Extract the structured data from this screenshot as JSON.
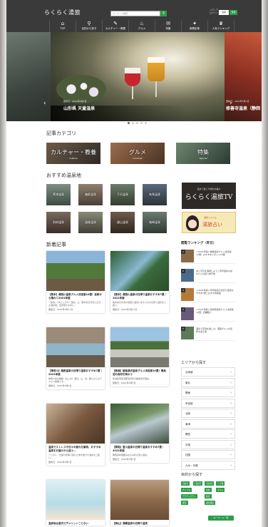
{
  "header": {
    "logo": "らくらく湯旅",
    "search_placeholder": "キーワード検索",
    "search_icon": "search-icon",
    "small_text_1": "メディア",
    "small_text_2": "ログイン",
    "button_1": "会員",
    "button_2": "登録"
  },
  "nav": [
    {
      "label": "TOP",
      "icon": "home-icon",
      "glyph": "⌂"
    },
    {
      "label": "目的から探す",
      "icon": "search-icon",
      "glyph": "⚲"
    },
    {
      "label": "カルチャー・教養",
      "icon": "book-icon",
      "glyph": "✎"
    },
    {
      "label": "グルメ",
      "icon": "food-icon",
      "glyph": "♨"
    },
    {
      "label": "特集",
      "icon": "mail-icon",
      "glyph": "✉"
    },
    {
      "label": "新着記事",
      "icon": "bell-icon",
      "glyph": "✦"
    },
    {
      "label": "人気ランキング",
      "icon": "crown-icon",
      "glyph": "♛"
    }
  ],
  "hero": {
    "date": "更新日：2021年5月8日",
    "title": "山形県 天童温泉",
    "date_right": "更新日：2021年3月2日",
    "title_right": "修善寺温泉（静岡",
    "arrow_left": "‹",
    "arrow_right": "›"
  },
  "sections": {
    "categories": "記事カテゴリ",
    "recommended": "おすすめ温泉地",
    "new_articles": "新着記事",
    "ranking": "閲覧ランキング（昨日）",
    "area": "エリアから探す",
    "purpose": "目的から探す"
  },
  "categories": [
    {
      "title": "カルチャー・教養",
      "sub": "Culture"
    },
    {
      "title": "グルメ",
      "sub": "Gourmet"
    },
    {
      "title": "特集",
      "sub": "Special"
    }
  ],
  "onsen": [
    "草津温泉",
    "箱根温泉",
    "下呂温泉",
    "有馬温泉",
    "別府温泉",
    "道後温泉",
    "銀山温泉",
    "城崎温泉"
  ],
  "banners": {
    "tv_sub": "温泉で過ごす旅をお届け",
    "tv_title": "らくらく湯旅TV",
    "uranai_sub": "温泉ソムリエ",
    "uranai_title": "湯旅占い"
  },
  "articles": [
    {
      "title": "【熊本】湯西川温泉グルメ決定版10選！自家から贈れて2021年度",
      "desc": "「熊本」（ゆにしがわ）温泉。山・鶴木県日光市に広がる温泉地。自然豊かな中に…",
      "date": "更新日：2021年3月17日"
    },
    {
      "title": "【熊本】湯西川温泉の日帰り温泉おすすめ7選｜2021年版",
      "desc": "栃木県日光市の湯西川温泉にある人気の日帰り温泉をご紹介。",
      "date": "更新日：2021年3月17日"
    },
    {
      "title": "【神奈川】箱根温泉の日帰り温泉おすすめ7選｜2021年版",
      "desc": "神奈川県の箱根（はこね）温泉。山、海、都心からのアクセス抜群です。",
      "date": "更新日：2021年3月5日"
    },
    {
      "title": "【新潟】越後湯沢温泉グルメ決定版10選！南魚沼の食材を味わう",
      "desc": "新潟県南魚沼郡湯沢町の越後湯沢温泉。",
      "date": "更新日：2021年3月5日"
    },
    {
      "title": "温泉でストレスや日々の疲れを解消、おすすめ温泉をお届けから迷う…",
      "desc": "デジタル・仕事や家事で疲れた体を癒やす温泉をご紹介。",
      "date": "更新日：2021年3月3日"
    },
    {
      "title": "【群馬】宝川温泉の日帰り温泉おすすめ7選｜2021年版",
      "desc": "群馬県利根郡みなかみ町の宝川温泉。",
      "date": "更新日：2021年3月3日"
    },
    {
      "title": "温泉地は室内でデメリットことない",
      "desc": "",
      "date": ""
    },
    {
      "title": "【岡山】湯郷温泉の日帰り温泉",
      "desc": "",
      "date": ""
    }
  ],
  "ranking": [
    "＜2021年版＞箱根温泉グルメ決定版10選！おすすめスポット23選",
    "冬に平戸を満喫しようと草津温泉も訪れたら日帰り旅行地",
    "＜2021年版＞草津温泉の日帰り温泉おすすめ7選とおすすめ施設",
    "＜2021年版＞湯布院温泉グルメ決定版10選！店舗紹介",
    "温泉で足湯を楽しむ！南国グルメの名所を巡る旅"
  ],
  "areas": [
    "北海道",
    "東北",
    "関東",
    "甲信越",
    "北陸",
    "東海",
    "関西",
    "中国",
    "四国",
    "九州・沖縄"
  ],
  "tags": [
    "日帰り",
    "1泊2日",
    "2泊3日",
    "一人旅",
    "カップル",
    "家族",
    "グルメ",
    "アクティビティ",
    "絶景",
    "夜景",
    "露天風呂"
  ],
  "more_button": "キーワード一覧"
}
